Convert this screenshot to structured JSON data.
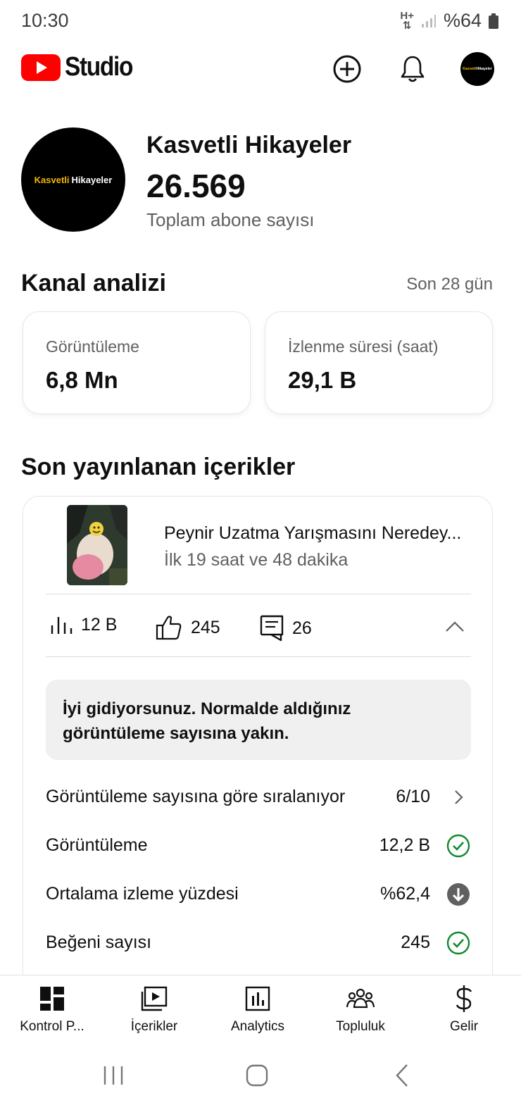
{
  "status_bar": {
    "time": "10:30",
    "network_up": "H+",
    "battery": "%64"
  },
  "header": {
    "logo_text": "Studio",
    "brand_color": "#ff0000"
  },
  "channel": {
    "avatar_text_a": "Kasvetli",
    "avatar_text_b": "Hikayeler",
    "name": "Kasvetli Hikayeler",
    "subscribers": "26.569",
    "subscribers_label": "Toplam abone sayısı"
  },
  "analytics": {
    "title": "Kanal analizi",
    "period": "Son 28 gün",
    "cards": [
      {
        "label": "Görüntüleme",
        "value": "6,8 Mn"
      },
      {
        "label": "İzlenme süresi (saat)",
        "value": "29,1 B"
      }
    ]
  },
  "recent": {
    "title": "Son yayınlanan içerikler",
    "video": {
      "title": "Peynir Uzatma Yarışmasını Neredey...",
      "age": "İlk 19 saat ve 48 dakika",
      "views": "12 B",
      "likes": "245",
      "comments": "26"
    },
    "notice": "İyi gidiyorsunuz. Normalde aldığınız görüntüleme sayısına yakın.",
    "rows": [
      {
        "label": "Görüntüleme sayısına göre sıralanıyor",
        "value": "6/10",
        "icon": "chevron-right-icon"
      },
      {
        "label": "Görüntüleme",
        "value": "12,2 B",
        "icon": "check-circle-icon"
      },
      {
        "label": "Ortalama izleme yüzdesi",
        "value": "%62,4",
        "icon": "arrow-down-circle-icon"
      },
      {
        "label": "Beğeni sayısı",
        "value": "245",
        "icon": "check-circle-icon"
      }
    ],
    "status_colors": {
      "good": "#0f8a2c",
      "down": "#606060"
    }
  },
  "bottom_nav": [
    {
      "label": "Kontrol P...",
      "icon": "dashboard-icon"
    },
    {
      "label": "İçerikler",
      "icon": "content-icon"
    },
    {
      "label": "Analytics",
      "icon": "analytics-icon"
    },
    {
      "label": "Topluluk",
      "icon": "community-icon"
    },
    {
      "label": "Gelir",
      "icon": "dollar-icon"
    }
  ]
}
